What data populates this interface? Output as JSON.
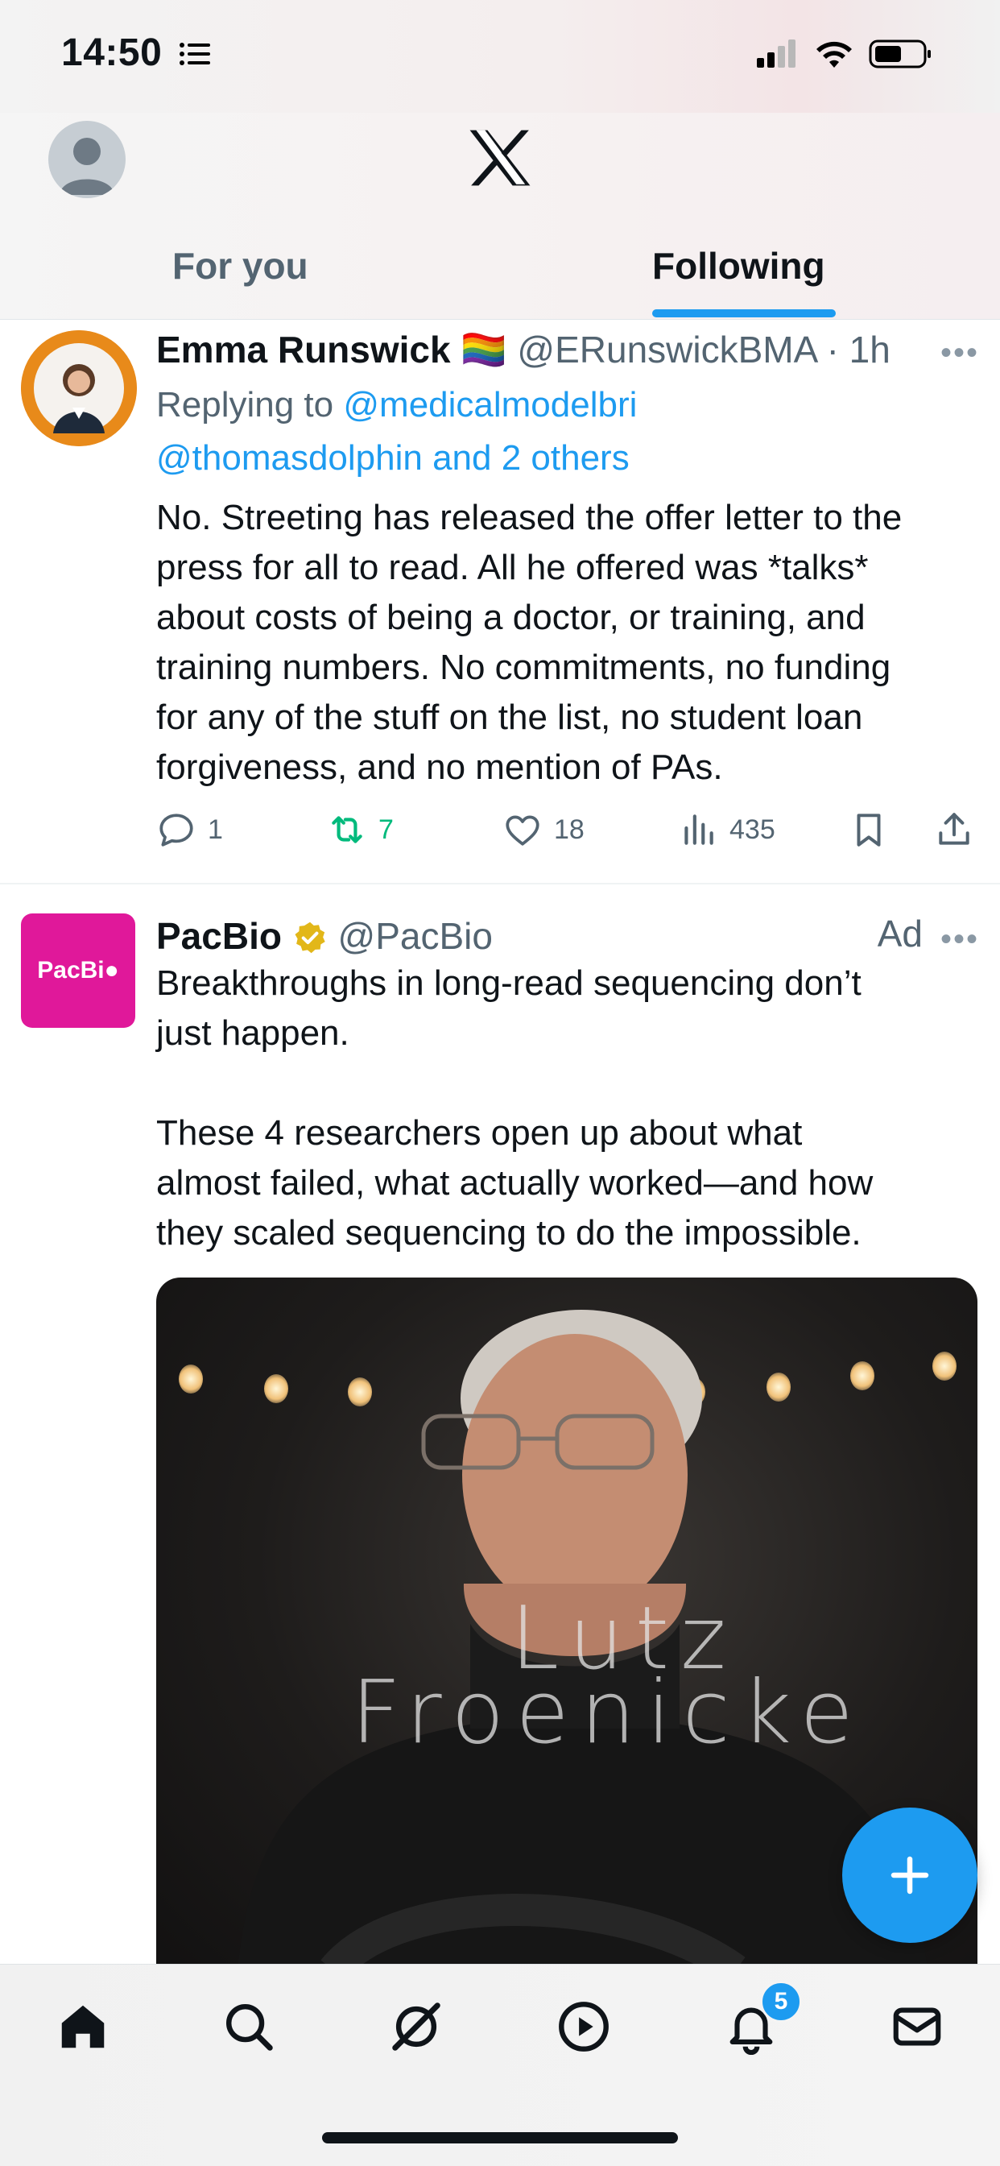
{
  "status_bar": {
    "time": "14:50"
  },
  "header": {
    "tabs": [
      {
        "label": "For you"
      },
      {
        "label": "Following"
      }
    ],
    "active_tab": "Following"
  },
  "tweets": [
    {
      "display_name": "Emma Runswick",
      "flag": "🏳️‍🌈",
      "handle": "@ERunswickBMA",
      "time": "· 1h",
      "reply_prefix": "Replying to",
      "reply_mention_1": "@medicalmodelbri",
      "reply_mention_2": "@thomasdolphin and 2 others",
      "text_lines": [
        "No. Streeting has released the offer letter to the",
        "press for all to read. All he offered was *talks*",
        "about costs of being a doctor, or training, and",
        "training numbers. No commitments, no funding",
        "for any of the stuff on the list, no student loan",
        "forgiveness, and no mention of PAs."
      ],
      "replies": "1",
      "retweets": "7",
      "likes": "18",
      "views": "435"
    },
    {
      "display_name": "PacBio",
      "handle": "@PacBio",
      "ad_label": "Ad",
      "avatar_text": "PacBi●",
      "text_lines": [
        "Breakthroughs in long-read sequencing don’t",
        "just happen.",
        "",
        "These 4 researchers open up about what",
        "almost failed, what actually worked—and how",
        "they scaled sequencing to do the impossible."
      ],
      "media_overlay_line1": "Lutz",
      "media_overlay_line2": "Froenicke"
    }
  ],
  "nav": {
    "notification_count": "5"
  },
  "colors": {
    "accent": "#1d9bf0",
    "retweet": "#00ba7c",
    "pacbio": "#e0189a"
  }
}
